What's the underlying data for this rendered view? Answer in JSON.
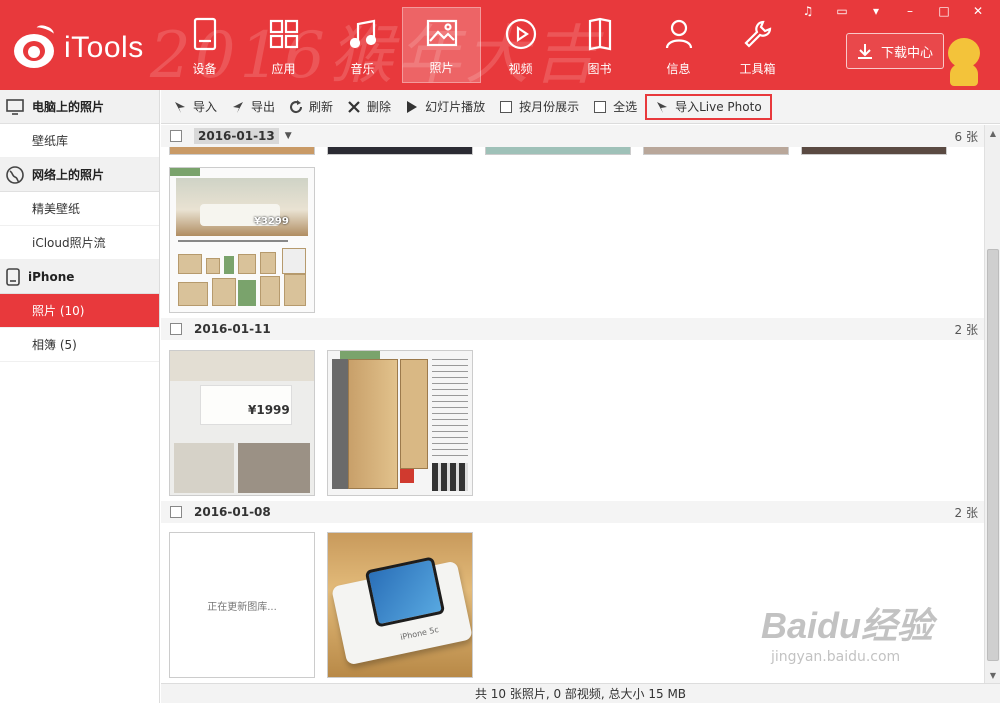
{
  "app": {
    "brand": "iTools",
    "banner_text": "2016猴年大吉"
  },
  "colors": {
    "accent": "#e8393c",
    "highlight_border": "#e8393c"
  },
  "nav": [
    {
      "label": "设备",
      "icon": "device-icon"
    },
    {
      "label": "应用",
      "icon": "apps-icon"
    },
    {
      "label": "音乐",
      "icon": "music-icon"
    },
    {
      "label": "照片",
      "icon": "photo-icon",
      "active": true
    },
    {
      "label": "视频",
      "icon": "video-icon"
    },
    {
      "label": "图书",
      "icon": "book-icon"
    },
    {
      "label": "信息",
      "icon": "contact-icon"
    },
    {
      "label": "工具箱",
      "icon": "toolbox-icon"
    }
  ],
  "download": {
    "label": "下载中心"
  },
  "window_controls": [
    "music-note-icon",
    "chat-icon",
    "menu-icon",
    "minimize-icon",
    "maximize-icon",
    "close-icon"
  ],
  "sidebar": {
    "sections": [
      {
        "title": "电脑上的照片",
        "icon": "monitor-icon",
        "items": [
          "壁纸库"
        ]
      },
      {
        "title": "网络上的照片",
        "icon": "globe-icon",
        "items": [
          "精美壁纸",
          "iCloud照片流"
        ]
      },
      {
        "title": "iPhone",
        "icon": "phone-icon",
        "items": [
          "照片 (10)",
          "相簿 (5)"
        ]
      }
    ],
    "active_item": "照片 (10)"
  },
  "toolbar": {
    "import": "导入",
    "export": "导出",
    "refresh": "刷新",
    "delete": "删除",
    "slideshow": "幻灯片播放",
    "by_month": "按月份展示",
    "select_all": "全选",
    "import_live": "导入Live Photo"
  },
  "groups": [
    {
      "date": "2016-01-13",
      "count": "6 张"
    },
    {
      "date": "2016-01-11",
      "count": "2 张"
    },
    {
      "date": "2016-01-08",
      "count": "2 张"
    }
  ],
  "thumbs": {
    "price_a": "¥3299",
    "price_b": "¥1999",
    "phone_caption": "iPhone 5c",
    "loading": "正在更新图库..."
  },
  "status": {
    "text": "共 10 张照片, 0 部视频, 总大小 15 MB"
  },
  "watermark": {
    "big": "Baidu经验",
    "small": "jingyan.baidu.com"
  }
}
